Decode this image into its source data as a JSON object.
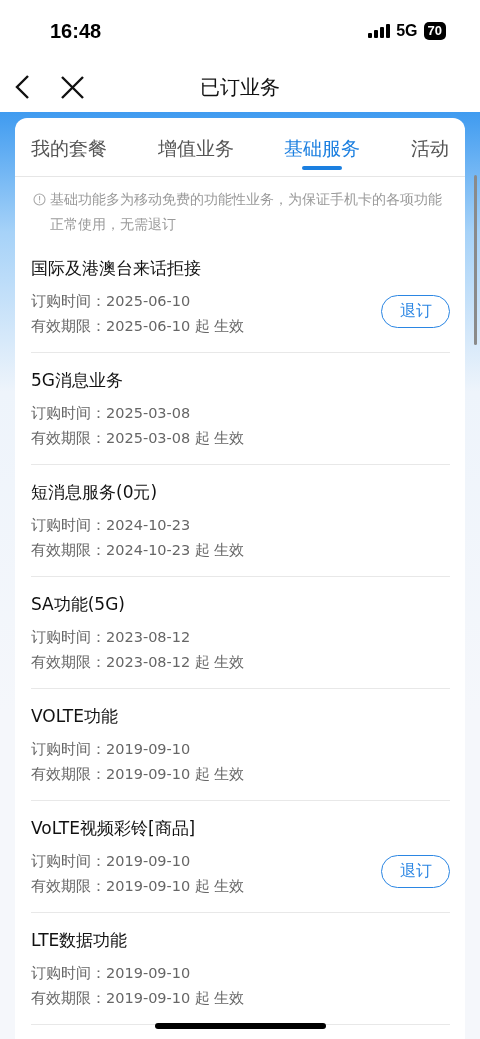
{
  "status_bar": {
    "time": "16:48",
    "network": "5G",
    "battery": "70"
  },
  "nav": {
    "title": "已订业务"
  },
  "tabs": [
    {
      "label": "我的套餐",
      "selected": false
    },
    {
      "label": "增值业务",
      "selected": false
    },
    {
      "label": "基础服务",
      "selected": true
    },
    {
      "label": "活动",
      "selected": false
    }
  ],
  "notice": "基础功能多为移动免费的功能性业务，为保证手机卡的各项功能正常使用，无需退订",
  "services": [
    {
      "name": "国际及港澳台来话拒接",
      "ordered": "订购时间：2025-06-10",
      "validity": "有效期限：2025-06-10 起 生效",
      "action": "退订"
    },
    {
      "name": "5G消息业务",
      "ordered": "订购时间：2025-03-08",
      "validity": "有效期限：2025-03-08 起 生效"
    },
    {
      "name": "短消息服务(0元)",
      "ordered": "订购时间：2024-10-23",
      "validity": "有效期限：2024-10-23 起 生效"
    },
    {
      "name": "SA功能(5G)",
      "ordered": "订购时间：2023-08-12",
      "validity": "有效期限：2023-08-12 起 生效"
    },
    {
      "name": "VOLTE功能",
      "ordered": "订购时间：2019-09-10",
      "validity": "有效期限：2019-09-10 起 生效"
    },
    {
      "name": "VoLTE视频彩铃[商品]",
      "ordered": "订购时间：2019-09-10",
      "validity": "有效期限：2019-09-10 起 生效",
      "action": "退订"
    },
    {
      "name": "LTE数据功能",
      "ordered": "订购时间：2019-09-10",
      "validity": "有效期限：2019-09-10 起 生效"
    }
  ]
}
